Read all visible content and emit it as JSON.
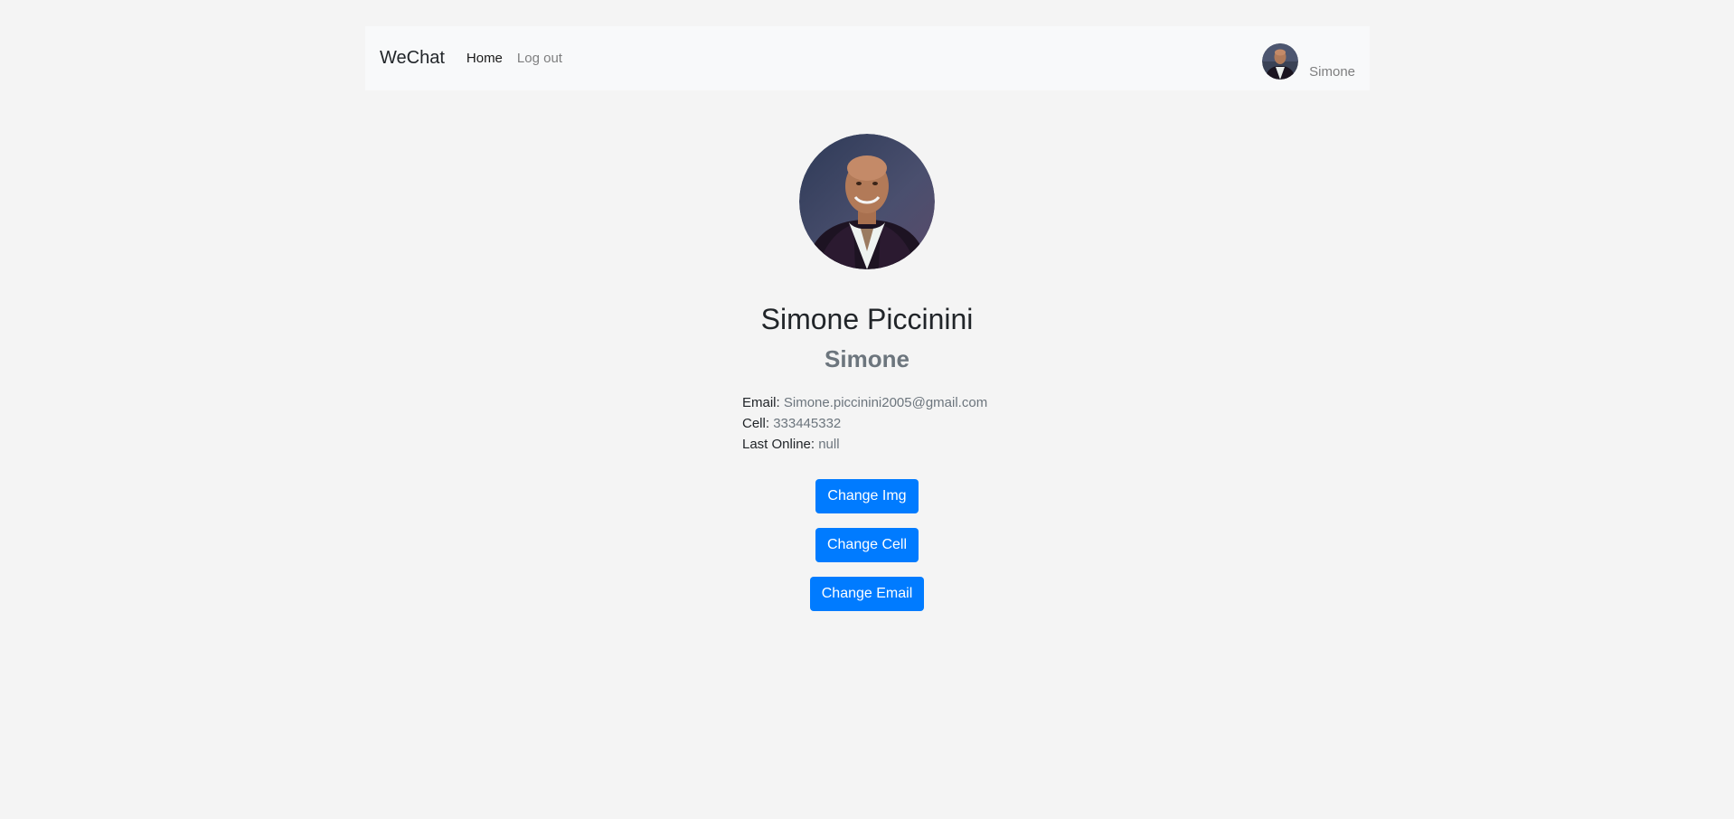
{
  "navbar": {
    "brand": "WeChat",
    "links": [
      {
        "label": "Home",
        "active": true
      },
      {
        "label": "Log out",
        "active": false
      }
    ],
    "user": {
      "name": "Simone",
      "avatar_icon": "user-avatar"
    }
  },
  "profile": {
    "avatar_icon": "profile-photo",
    "full_name": "Simone Piccinini",
    "username": "Simone",
    "email_label": "Email:",
    "email": "Simone.piccinini2005@gmail.com",
    "cell_label": "Cell:",
    "cell": "333445332",
    "last_online_label": "Last Online:",
    "last_online": "null"
  },
  "actions": {
    "change_img": "Change Img",
    "change_cell": "Change Cell",
    "change_email": "Change Email"
  },
  "colors": {
    "primary": "#007bff",
    "navbar_bg": "#f8f9fa",
    "page_bg": "#f4f4f4"
  }
}
